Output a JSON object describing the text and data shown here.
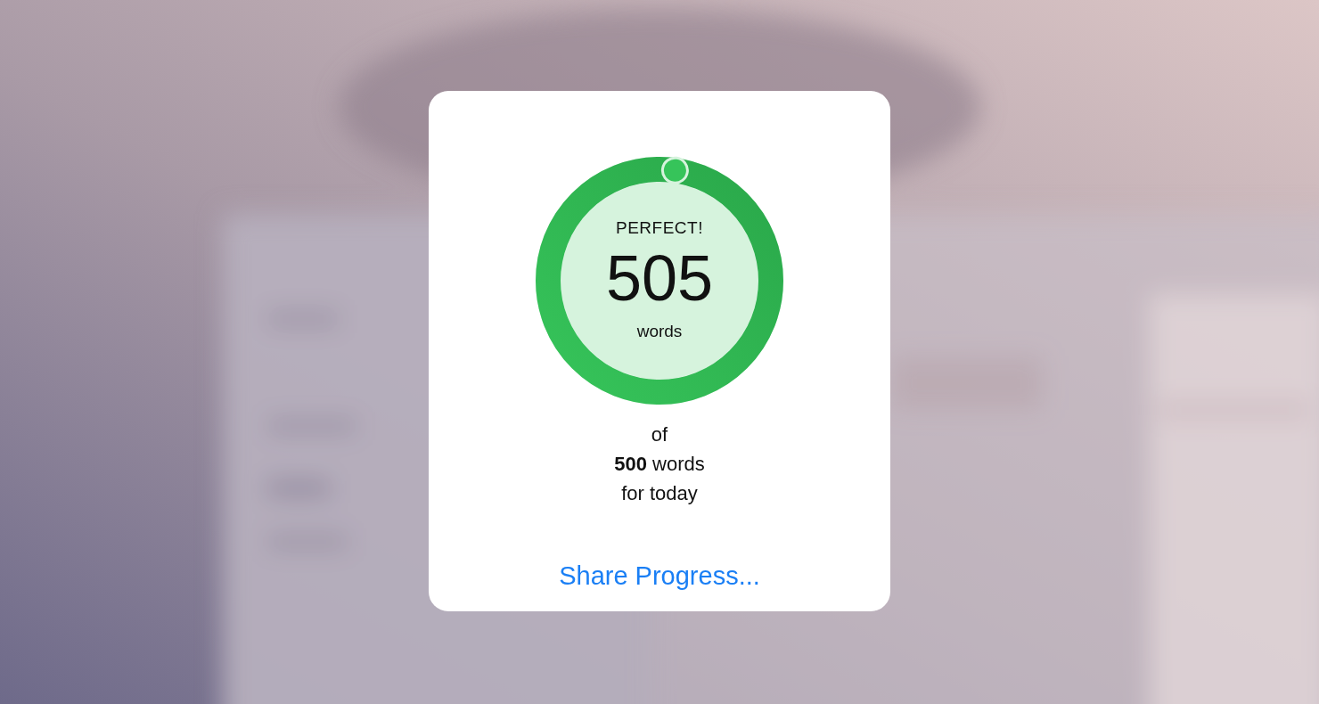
{
  "progress": {
    "status": "PERFECT!",
    "count": "505",
    "unit": "words",
    "level": 1
  },
  "goal_lines": [
    "of",
    "**500** words",
    "for today"
  ],
  "share_button": {
    "label": "Share Progress..."
  }
}
